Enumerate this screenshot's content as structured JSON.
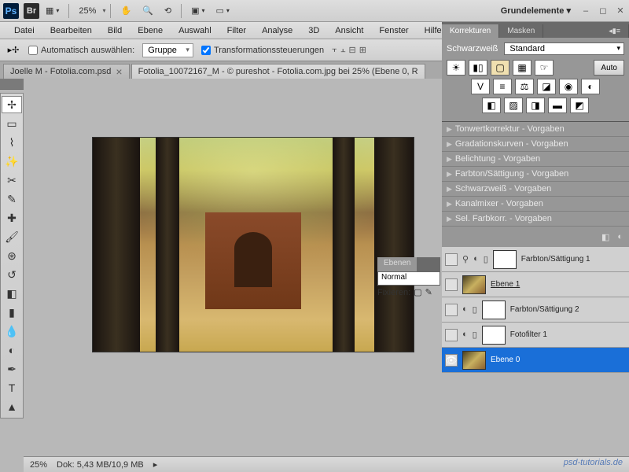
{
  "app": {
    "zoom": "25%",
    "workspace": "Grundelemente"
  },
  "menu": [
    "Datei",
    "Bearbeiten",
    "Bild",
    "Ebene",
    "Auswahl",
    "Filter",
    "Analyse",
    "3D",
    "Ansicht",
    "Fenster",
    "Hilfe"
  ],
  "options": {
    "auto_select": "Automatisch auswählen:",
    "group": "Gruppe",
    "transform": "Transformationssteuerungen"
  },
  "tabs": [
    {
      "title": "Joelle M - Fotolia.com.psd"
    },
    {
      "title": "Fotolia_10072167_M - © pureshot - Fotolia.com.jpg bei 25% (Ebene 0, R"
    }
  ],
  "status": {
    "zoom": "25%",
    "doc": "Dok: 5,43 MB/10,9 MB"
  },
  "adjustments": {
    "tab1": "Korrekturen",
    "tab2": "Masken",
    "bw_label": "Schwarzweiß",
    "preset": "Standard",
    "auto": "Auto",
    "presets": [
      "Tonwertkorrektur - Vorgaben",
      "Gradationskurven - Vorgaben",
      "Belichtung - Vorgaben",
      "Farbton/Sättigung - Vorgaben",
      "Schwarzweiß - Vorgaben",
      "Kanalmixer - Vorgaben",
      "Sel. Farbkorr. - Vorgaben"
    ]
  },
  "layers_panel": {
    "tab": "Ebenen",
    "blend": "Normal",
    "lock": "Fixieren:",
    "layers": [
      {
        "name": "Farbton/Sättigung 1",
        "thumb": "white"
      },
      {
        "name": "Ebene 1",
        "thumb": "img"
      },
      {
        "name": "Farbton/Sättigung 2",
        "thumb": "white"
      },
      {
        "name": "Fotofilter 1",
        "thumb": "white"
      },
      {
        "name": "Ebene 0",
        "thumb": "img",
        "selected": true,
        "visible": true
      }
    ]
  },
  "watermark": "psd-tutorials.de"
}
